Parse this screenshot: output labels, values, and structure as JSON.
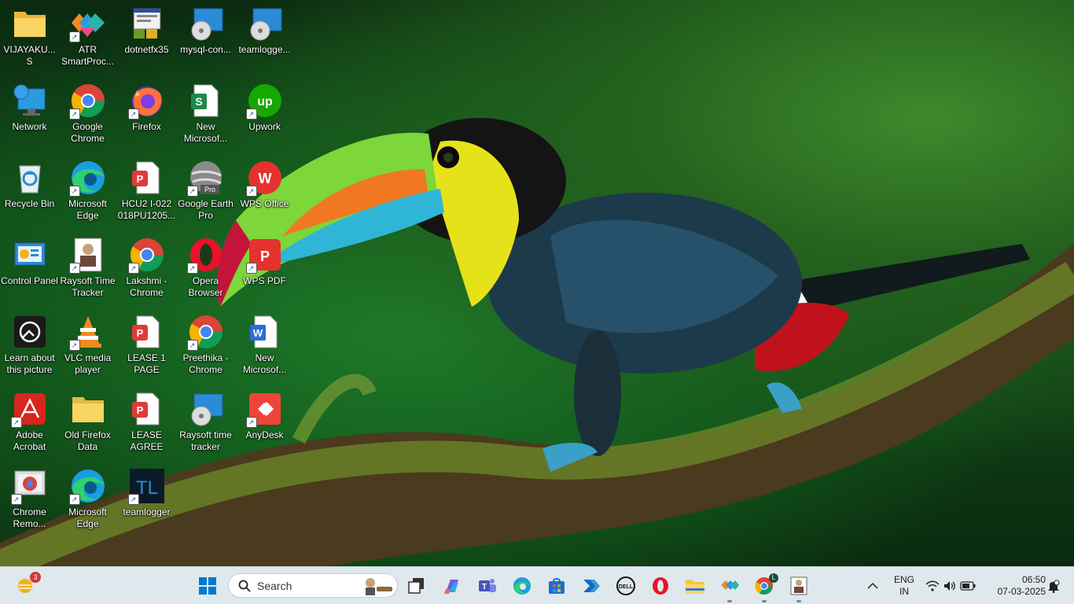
{
  "desktop": {
    "icons": [
      {
        "label": "VIJAYAKU...\nS",
        "icon": "folder-icon"
      },
      {
        "label": "ATR SmartProc...",
        "icon": "atr-smartprocess-icon"
      },
      {
        "label": "dotnetfx35",
        "icon": "installer-icon"
      },
      {
        "label": "mysql-con...",
        "icon": "disc-setup-icon"
      },
      {
        "label": "teamlogge...",
        "icon": "disc-setup-icon"
      },
      {
        "label": "Network",
        "icon": "network-icon"
      },
      {
        "label": "Google Chrome",
        "icon": "chrome-icon"
      },
      {
        "label": "Firefox",
        "icon": "firefox-icon"
      },
      {
        "label": "New Microsof...",
        "icon": "excel-sheet-icon"
      },
      {
        "label": "Upwork",
        "icon": "upwork-icon"
      },
      {
        "label": "Recycle Bin",
        "icon": "recycle-bin-icon"
      },
      {
        "label": "Microsoft Edge",
        "icon": "edge-icon"
      },
      {
        "label": "HCU2 I-022 018PU1205...",
        "icon": "pdf-document-icon"
      },
      {
        "label": "Google Earth Pro",
        "icon": "google-earth-icon"
      },
      {
        "label": "WPS Office",
        "icon": "wps-office-icon"
      },
      {
        "label": "Control Panel",
        "icon": "control-panel-icon"
      },
      {
        "label": "Raysoft Time Tracker",
        "icon": "raysoft-icon"
      },
      {
        "label": "Lakshmi - Chrome",
        "icon": "chrome-profile-icon"
      },
      {
        "label": "Opera Browser",
        "icon": "opera-icon"
      },
      {
        "label": "WPS PDF",
        "icon": "wps-pdf-icon"
      },
      {
        "label": "Learn about this picture",
        "icon": "learn-picture-icon"
      },
      {
        "label": "VLC media player",
        "icon": "vlc-icon"
      },
      {
        "label": "LEASE 1 PAGE",
        "icon": "pdf-document-icon"
      },
      {
        "label": "Preethika - Chrome",
        "icon": "chrome-profile-icon"
      },
      {
        "label": "New Microsof...",
        "icon": "word-document-icon"
      },
      {
        "label": "Adobe Acrobat",
        "icon": "acrobat-icon"
      },
      {
        "label": "Old Firefox Data",
        "icon": "folder-icon"
      },
      {
        "label": "LEASE AGREE",
        "icon": "pdf-document-icon"
      },
      {
        "label": "Raysoft time tracker",
        "icon": "disc-setup-icon"
      },
      {
        "label": "AnyDesk",
        "icon": "anydesk-icon"
      },
      {
        "label": "Chrome Remo...",
        "icon": "chrome-remote-icon"
      },
      {
        "label": "Microsoft Edge",
        "icon": "edge-icon"
      },
      {
        "label": "teamlogger",
        "icon": "teamlogger-icon"
      }
    ]
  },
  "taskbar": {
    "weather_badge": "3",
    "search_placeholder": "Search",
    "apps": [
      "start-button",
      "task-view",
      "copilot",
      "teams",
      "edge",
      "microsoft-store",
      "power-automate",
      "dell",
      "opera",
      "file-explorer",
      "atr",
      "chrome-lakshmi",
      "raysoft"
    ],
    "chrome_profile_letter": "L",
    "tray": {
      "lang_top": "ENG",
      "lang_bottom": "IN",
      "time": "06:50",
      "date": "07-03-2025"
    }
  },
  "colors": {
    "taskbar_bg": "#dfe8ec",
    "wallpaper_green": "#135c1d"
  }
}
